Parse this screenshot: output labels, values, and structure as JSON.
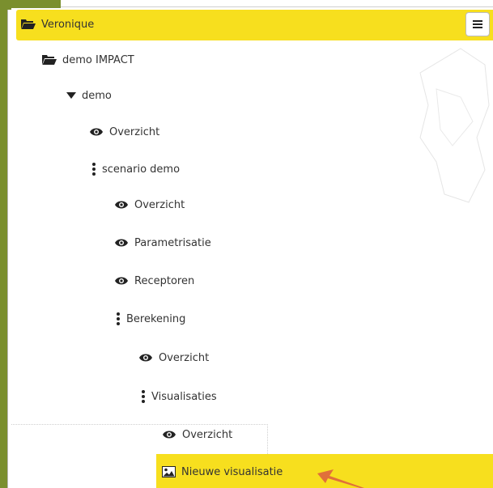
{
  "tree": {
    "root": {
      "label": "Veronique",
      "icon": "folder-open-icon"
    },
    "items": [
      {
        "label": "demo IMPACT",
        "icon": "folder-open-icon"
      },
      {
        "label": "demo",
        "icon": "caret-down-icon"
      },
      {
        "label": "Overzicht",
        "icon": "eye-icon"
      },
      {
        "label": "scenario demo",
        "icon": "vertical-dots-icon"
      },
      {
        "label": "Overzicht",
        "icon": "eye-icon"
      },
      {
        "label": "Parametrisatie",
        "icon": "eye-icon"
      },
      {
        "label": "Receptoren",
        "icon": "eye-icon"
      },
      {
        "label": "Berekening",
        "icon": "vertical-dots-icon"
      },
      {
        "label": "Overzicht",
        "icon": "eye-icon"
      },
      {
        "label": "Visualisaties",
        "icon": "vertical-dots-icon"
      },
      {
        "label": "Overzicht",
        "icon": "eye-icon"
      },
      {
        "label": "Nieuwe visualisatie",
        "icon": "image-icon"
      }
    ]
  },
  "menu_button": {
    "icon": "hamburger-menu-icon"
  },
  "colors": {
    "highlight": "#f7df1e",
    "frame_green": "#7a8f2e",
    "arrow": "#e0703a"
  }
}
